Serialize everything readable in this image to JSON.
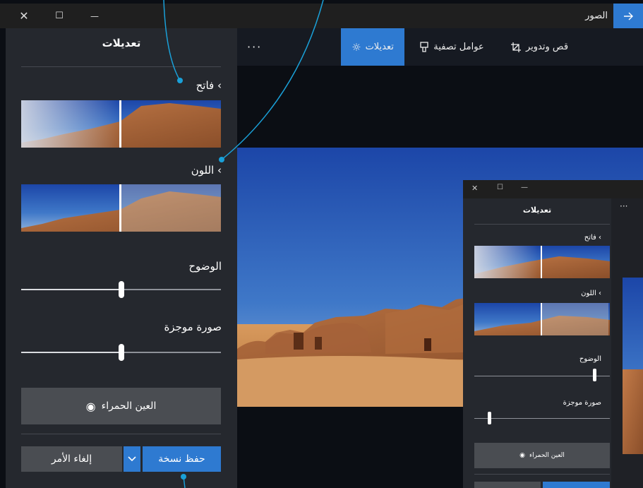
{
  "titlebar": {
    "app_title": "الصور",
    "back_icon": "arrow-right-icon",
    "close_glyph": "✕",
    "maximize_glyph": "☐",
    "minimize_glyph": "—"
  },
  "toolbar": {
    "more_glyph": "···",
    "crop_label": "قص وتدوير",
    "filters_label": "عوامل تصفية",
    "adjust_label": "تعديلات"
  },
  "panel": {
    "title": "تعديلات",
    "light_label": "فاتح",
    "color_label": "اللون",
    "clarity_label": "الوضوح",
    "clarity_value": 0.5,
    "vignette_label": "صورة موجزة",
    "vignette_value": 0.5,
    "redeye_label": "العين الحمراء",
    "save_label": "حفظ نسخة",
    "cancel_label": "إلغاء الأمر",
    "chevron": "‹"
  },
  "inner_window": {
    "close_glyph": "✕",
    "maximize_glyph": "☐",
    "minimize_glyph": "—",
    "title": "تعديلات",
    "light_label": "فاتح",
    "color_label": "اللون",
    "clarity_label": "الوضوح",
    "clarity_value": 0.89,
    "vignette_label": "صورة موجزة",
    "vignette_value": 0.11,
    "redeye_label": "العين الحمراء",
    "more_glyph": "···",
    "chevron": "‹"
  },
  "colors": {
    "accent": "#2e7ad1",
    "callout": "#1aa0d8"
  }
}
